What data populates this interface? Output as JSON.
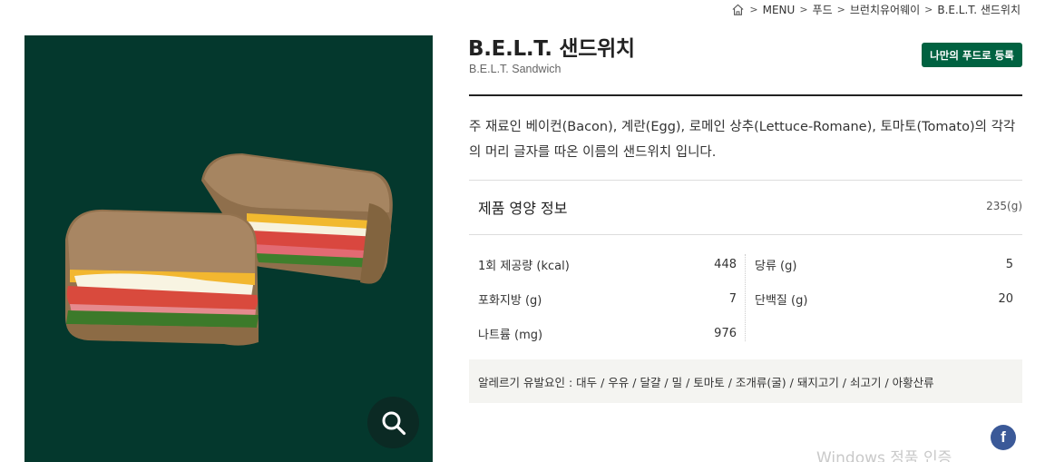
{
  "breadcrumb": {
    "items": [
      "MENU",
      "푸드",
      "브런치유어웨이",
      "B.E.L.T. 샌드위치"
    ]
  },
  "product": {
    "title": "B.E.L.T. 샌드위치",
    "subtitle": "B.E.L.T. Sandwich",
    "register_label": "나만의 푸드로 등록",
    "description": "주 재료인 베이컨(Bacon), 계란(Egg), 로메인 상추(Lettuce-Romane), 토마토(Tomato)의 각각의 머리 글자를 따온 이름의 샌드위치 입니다."
  },
  "nutrition": {
    "title": "제품 영양 정보",
    "serving": "235(g)",
    "left": [
      {
        "label": "1회 제공량 (kcal)",
        "value": "448"
      },
      {
        "label": "포화지방 (g)",
        "value": "7"
      },
      {
        "label": "나트륨 (mg)",
        "value": "976"
      }
    ],
    "right": [
      {
        "label": "당류 (g)",
        "value": "5"
      },
      {
        "label": "단백질 (g)",
        "value": "20"
      }
    ]
  },
  "allergy": {
    "text": "알레르기 유발요인 : 대두 / 우유 / 달걀 / 밀 / 토마토 / 조개류(굴) / 돼지고기 / 쇠고기 / 아황산류"
  },
  "social": {
    "facebook": "f"
  },
  "watermark": "Windows 정품 인증",
  "colors": {
    "image_bg": "#04382d",
    "register_button": "#006241",
    "facebook": "#3b5998",
    "allergy_bg": "#f4f4f1"
  },
  "icons": [
    "home-icon",
    "chevron-right-icon",
    "search-icon",
    "facebook-icon"
  ]
}
